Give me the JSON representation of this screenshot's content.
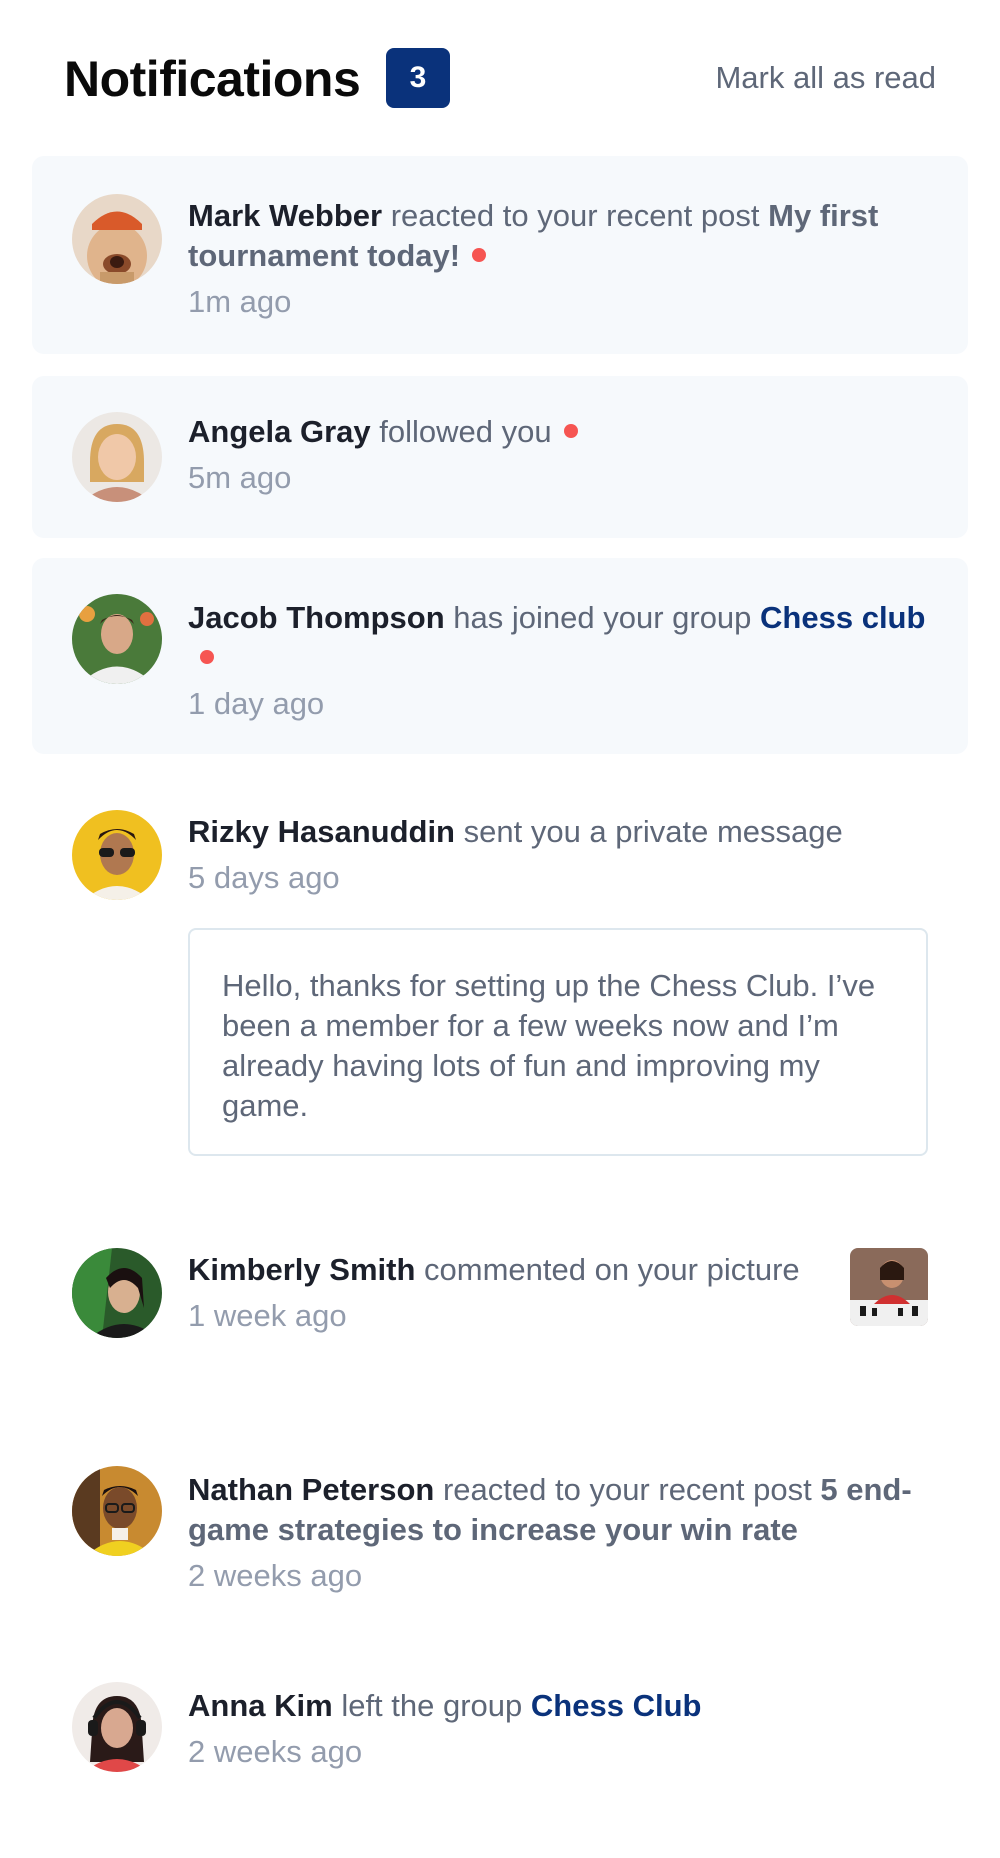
{
  "header": {
    "title": "Notifications",
    "unread_count": "3",
    "mark_all_label": "Mark all as read"
  },
  "notifications": [
    {
      "name": "Mark Webber",
      "action": "reacted to your recent post",
      "target": "My first tournament today!",
      "time": "1m ago",
      "unread": true,
      "avatar_icon": "avatar-mark-webber"
    },
    {
      "name": "Angela Gray",
      "action": "followed you",
      "target": "",
      "time": "5m ago",
      "unread": true,
      "avatar_icon": "avatar-angela-gray"
    },
    {
      "name": "Jacob Thompson",
      "action": "has joined your group",
      "target": "Chess club",
      "time": "1 day ago",
      "unread": true,
      "avatar_icon": "avatar-jacob-thompson"
    },
    {
      "name": "Rizky Hasanuddin",
      "action": "sent you a private message",
      "target": "",
      "time": "5 days ago",
      "unread": false,
      "message": "Hello, thanks for setting up the Chess Club. I’ve been a member for a few weeks now and I’m already having lots of fun and improving my game.",
      "avatar_icon": "avatar-rizky-hasanuddin"
    },
    {
      "name": "Kimberly Smith",
      "action": "commented on your picture",
      "target": "",
      "time": "1 week ago",
      "unread": false,
      "thumbnail_icon": "chess-picture-thumbnail",
      "avatar_icon": "avatar-kimberly-smith"
    },
    {
      "name": "Nathan Peterson",
      "action": "reacted to your recent post",
      "target": "5 end-game strategies to increase your win rate",
      "time": "2 weeks ago",
      "unread": false,
      "avatar_icon": "avatar-nathan-peterson"
    },
    {
      "name": "Anna Kim",
      "action": "left the group",
      "target": "Chess Club",
      "time": "2 weeks ago",
      "unread": false,
      "avatar_icon": "avatar-anna-kim"
    }
  ],
  "colors": {
    "badge": "#0a327b",
    "unread_bg": "#f6f9fc",
    "dot": "#f65552",
    "name": "#1c202b",
    "text": "#5e6778",
    "muted": "#939cad"
  }
}
